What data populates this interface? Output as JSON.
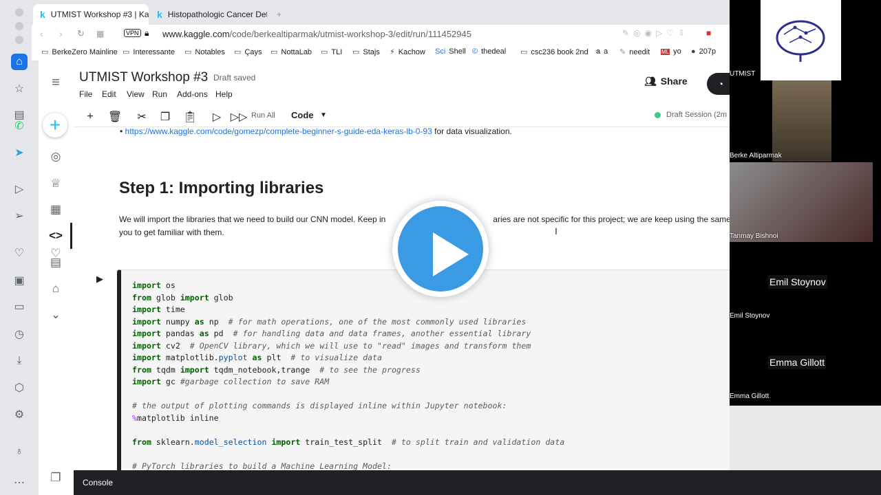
{
  "tabs": [
    {
      "label": "UTMIST Workshop #3 | Kaggle",
      "active": true
    },
    {
      "label": "Histopathologic Cancer Detecti",
      "active": false
    }
  ],
  "address": {
    "vpn": "VPN",
    "host": "www.kaggle.com",
    "path": "/code/berkealtiparmak/utmist-workshop-3/edit/run/111452945"
  },
  "bookmarks": [
    "BerkeZero Mainline",
    "Interessante",
    "Notables",
    "Çays",
    "NottaLab",
    "TLI",
    "Stajs",
    "Kachow",
    "Shell",
    "thedeal",
    "csc236 book 2nd",
    "a",
    "needit",
    "yo",
    "207p"
  ],
  "notebook": {
    "title": "UTMIST Workshop #3",
    "status": "Draft saved",
    "menu": [
      "File",
      "Edit",
      "View",
      "Run",
      "Add-ons",
      "Help"
    ],
    "run_all": "Run All",
    "cell_type": "Code",
    "session": "Draft Session (2m",
    "share": "Share"
  },
  "content": {
    "link": "https://www.kaggle.com/code/gomezp/complete-beginner-s-guide-eda-keras-lb-0-93",
    "link_suffix": " for data visualization.",
    "heading": "Step 1: Importing libraries",
    "para_1": "We will import the libraries that we need to build our CNN model. Keep in",
    "para_2": "aries are not specific for this project; we are keep using the same",
    "para_3": "you to get familiar with them."
  },
  "console": "Console",
  "zoom": {
    "brand": "UTMIST",
    "participants": [
      "Berke Altiparmak",
      "Tanmay Bishnoi",
      "Emil Stoynov",
      "Emma Gillott"
    ]
  },
  "colors": {
    "kaggle_blue": "#20beff",
    "play_blue": "#3a9ae3",
    "link": "#1a73e8"
  }
}
